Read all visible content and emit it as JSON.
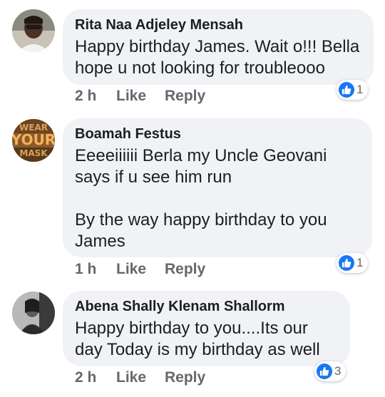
{
  "comments": [
    {
      "author": "Rita Naa Adjeley Mensah",
      "text": "Happy birthday James. Wait o!!! Bella hope u not looking for troubleooo",
      "time": "2 h",
      "like_label": "Like",
      "reply_label": "Reply",
      "reaction_count": "1",
      "reaction_icon": "thumbs-up-icon",
      "avatar": "woman-portrait"
    },
    {
      "author": "Boamah Festus",
      "text": "Eeeeiiiiii Berla my Uncle Geovani says if u see him run\n\nBy the way happy birthday to you James",
      "time": "1 h",
      "like_label": "Like",
      "reply_label": "Reply",
      "reaction_count": "1",
      "reaction_icon": "thumbs-up-icon",
      "avatar_text_top": "WEAR",
      "avatar_text_mid": "YOUR",
      "avatar_text_bot": "MASK"
    },
    {
      "author": "Abena Shally Klenam Shallorm",
      "text": "Happy birthday to you....Its our day Today is my birthday as well",
      "time": "2 h",
      "like_label": "Like",
      "reply_label": "Reply",
      "reaction_count": "3",
      "reaction_icon": "thumbs-up-icon",
      "avatar": "grayscale-portrait"
    }
  ],
  "colors": {
    "bubble": "#f0f2f5",
    "text": "#1c1e21",
    "meta": "#65676b",
    "like_blue": "#1877f2"
  }
}
